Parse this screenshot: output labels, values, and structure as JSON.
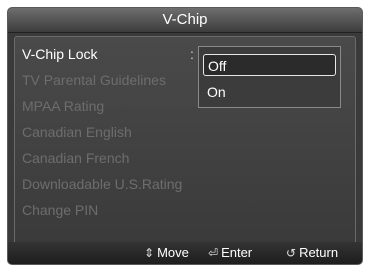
{
  "window": {
    "title": "V-Chip"
  },
  "menu": {
    "items": [
      {
        "label": "V-Chip Lock",
        "enabled": true
      },
      {
        "label": "TV Parental Guidelines",
        "enabled": false
      },
      {
        "label": "MPAA Rating",
        "enabled": false
      },
      {
        "label": "Canadian English",
        "enabled": false
      },
      {
        "label": "Canadian French",
        "enabled": false
      },
      {
        "label": "Downloadable U.S.Rating",
        "enabled": false
      },
      {
        "label": "Change PIN",
        "enabled": false
      }
    ],
    "separator": ":"
  },
  "dropdown": {
    "options": [
      "Off",
      "On"
    ],
    "selected": "Off"
  },
  "footer": {
    "move": {
      "icon": "up-down-icon",
      "label": "Move"
    },
    "enter": {
      "icon": "enter-icon",
      "label": "Enter"
    },
    "return": {
      "icon": "return-icon",
      "label": "Return"
    }
  }
}
